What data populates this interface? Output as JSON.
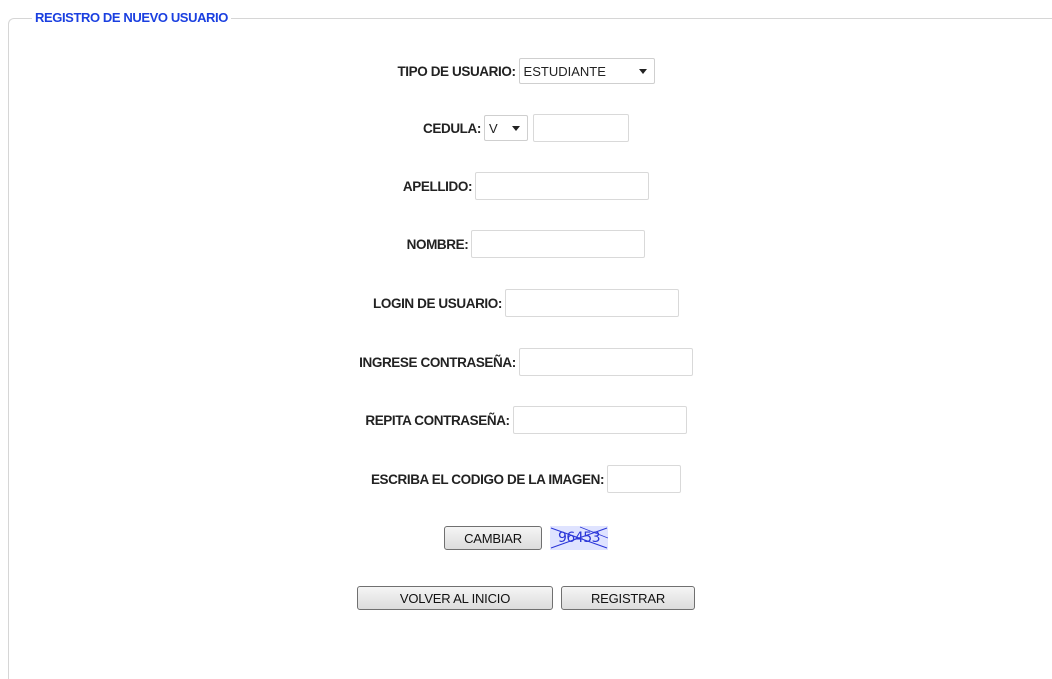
{
  "form": {
    "legend": "REGISTRO DE NUEVO USUARIO",
    "tipo_usuario": {
      "label": "TIPO DE USUARIO:",
      "selected": "ESTUDIANTE"
    },
    "cedula": {
      "label": "CEDULA:",
      "prefix_selected": "V",
      "value": ""
    },
    "apellido": {
      "label": "APELLIDO:",
      "value": ""
    },
    "nombre": {
      "label": "NOMBRE:",
      "value": ""
    },
    "login": {
      "label": "LOGIN DE USUARIO:",
      "value": ""
    },
    "password": {
      "label": "INGRESE CONTRASEÑA:",
      "value": ""
    },
    "password_repeat": {
      "label": "REPITA CONTRASEÑA:",
      "value": ""
    },
    "captcha_input": {
      "label": "ESCRIBA EL CODIGO DE LA IMAGEN:",
      "value": ""
    },
    "captcha": {
      "change_label": "CAMBIAR",
      "code": "96453"
    },
    "buttons": {
      "back_label": "VOLVER AL INICIO",
      "register_label": "REGISTRAR"
    }
  },
  "colors": {
    "legend": "#1a3fe0",
    "captcha_text": "#2a35d8",
    "captcha_bg": "#dfe3ff"
  }
}
